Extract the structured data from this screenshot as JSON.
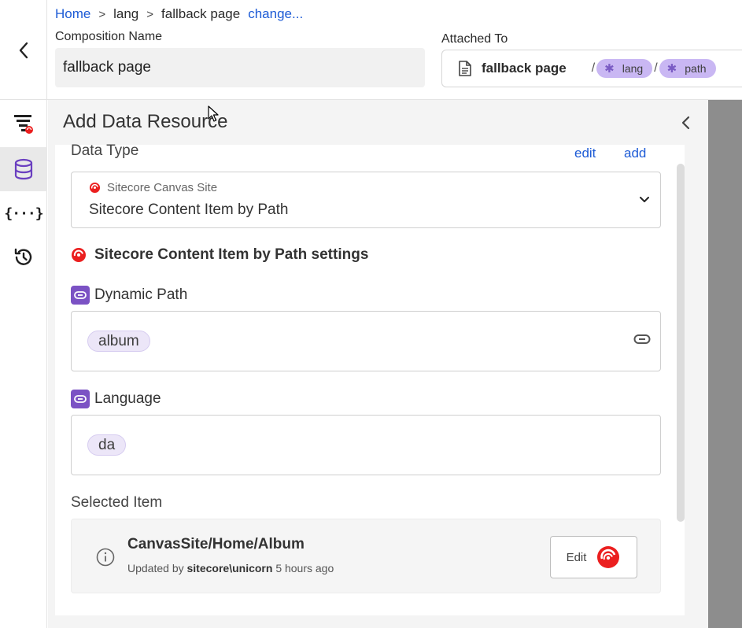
{
  "breadcrumb": {
    "home": "Home",
    "sep": ">",
    "lang": "lang",
    "page": "fallback page",
    "change": "change..."
  },
  "composition": {
    "label": "Composition Name",
    "value": "fallback page"
  },
  "attached": {
    "label": "Attached To",
    "page": "fallback page",
    "slash": "/",
    "tokens": [
      "lang",
      "path"
    ],
    "token_glyph": "✱"
  },
  "rail": {
    "icons": [
      "layout-icon",
      "database-icon",
      "braces-icon",
      "history-icon"
    ],
    "braces_text": "{···}"
  },
  "panel": {
    "title": "Add Data Resource",
    "data_type_label": "Data Type",
    "edit_link": "edit",
    "add_link": "add",
    "select_site": "Sitecore Canvas Site",
    "select_value": "Sitecore Content Item by Path",
    "settings_title": "Sitecore Content Item by Path settings",
    "dynamic_path_label": "Dynamic Path",
    "dynamic_path_token": "album",
    "language_label": "Language",
    "language_token": "da",
    "selected_item_label": "Selected Item",
    "item_path": "CanvasSite/Home/Album",
    "item_updated_prefix": "Updated by",
    "item_updated_user": "sitecore\\unicorn",
    "item_updated_time": "5 hours ago",
    "edit_button": "Edit"
  },
  "colors": {
    "accent_blue": "#1d5bd6",
    "purple": "#7b52c4",
    "pill_purple": "#c9b7f3",
    "sitecore_red": "#eb1f1f"
  }
}
